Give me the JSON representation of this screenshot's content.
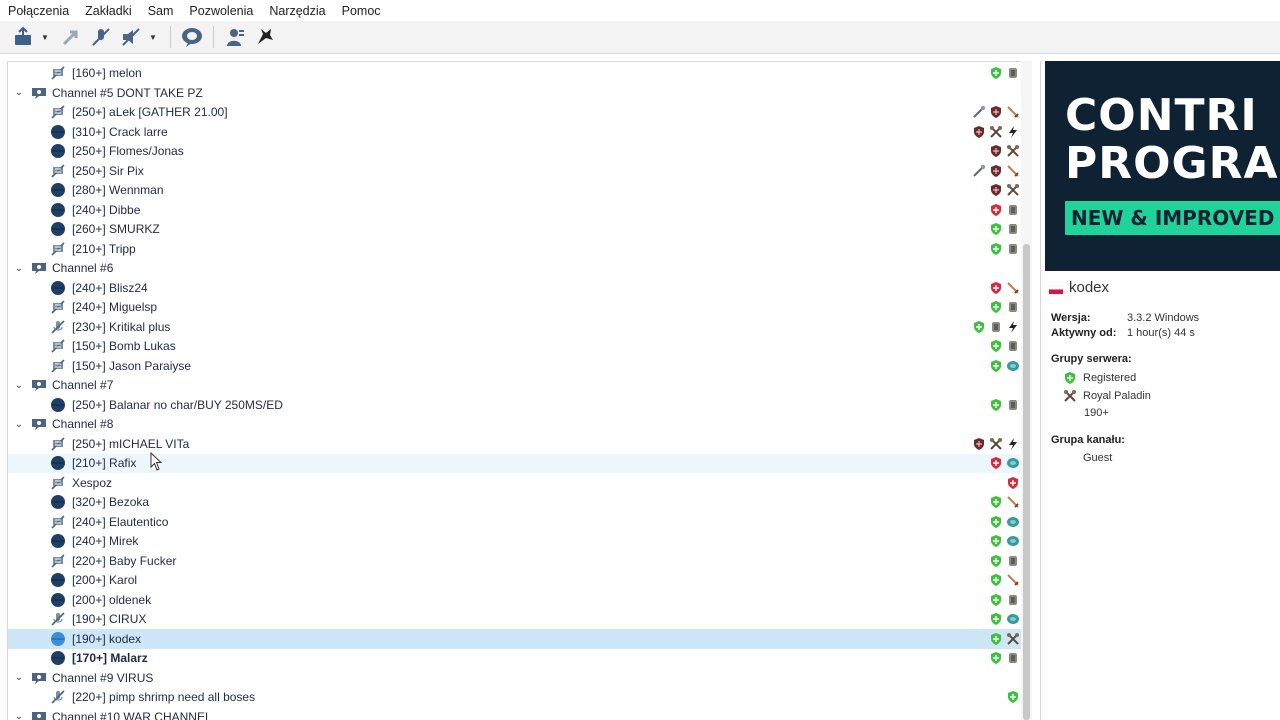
{
  "menu": [
    "Połączenia",
    "Zakładki",
    "Sam",
    "Pozwolenia",
    "Narzędzia",
    "Pomoc"
  ],
  "tree": [
    {
      "kind": "user",
      "name": "[160+] melon",
      "icon": "muted-user-icon",
      "badges": [
        "green-shield",
        "gray-armor"
      ]
    },
    {
      "kind": "channel",
      "name": "Channel #5 DONT TAKE PZ"
    },
    {
      "kind": "user",
      "name": "[250+] aLek [GATHER 21.00]",
      "icon": "muted-user-icon",
      "badges": [
        "wand",
        "dark-shield",
        "sword"
      ]
    },
    {
      "kind": "user",
      "name": "[310+] Crack larre",
      "icon": "idle-user-icon",
      "badges": [
        "dark-shield",
        "cross-axes",
        "bolt"
      ]
    },
    {
      "kind": "user",
      "name": "[250+] Flomes/Jonas",
      "icon": "idle-user-icon",
      "badges": [
        "dark-shield",
        "cross-axes"
      ]
    },
    {
      "kind": "user",
      "name": "[250+] Sir Pix",
      "icon": "muted-user-icon",
      "badges": [
        "wand",
        "dark-shield",
        "sword"
      ]
    },
    {
      "kind": "user",
      "name": "[280+] Wennman",
      "icon": "idle-user-icon",
      "badges": [
        "dark-shield",
        "cross-axes"
      ]
    },
    {
      "kind": "user",
      "name": "[240+] Dibbe",
      "icon": "idle-user-icon",
      "badges": [
        "red-shield",
        "gray-armor"
      ]
    },
    {
      "kind": "user",
      "name": "[260+] SMURKZ",
      "icon": "idle-user-icon",
      "badges": [
        "green-shield",
        "gray-armor"
      ]
    },
    {
      "kind": "user",
      "name": "[210+] Tripp",
      "icon": "muted-user-icon",
      "badges": [
        "green-shield",
        "gray-armor"
      ]
    },
    {
      "kind": "channel",
      "name": "Channel #6"
    },
    {
      "kind": "user",
      "name": "[240+] Blisz24",
      "icon": "idle-user-icon",
      "badges": [
        "red-shield",
        "sword"
      ]
    },
    {
      "kind": "user",
      "name": "[240+] Miguelsp",
      "icon": "muted-user-icon",
      "badges": [
        "green-shield",
        "gray-armor"
      ]
    },
    {
      "kind": "user",
      "name": "[230+] Kritikal plus",
      "icon": "away-user-icon",
      "badges": [
        "green-shield",
        "gray-armor",
        "bolt"
      ]
    },
    {
      "kind": "user",
      "name": "[150+] Bomb Lukas",
      "icon": "muted-user-icon",
      "badges": [
        "green-shield",
        "gray-armor"
      ]
    },
    {
      "kind": "user",
      "name": "[150+] Jason Paraiyse",
      "icon": "muted-user-icon",
      "badges": [
        "green-shield",
        "teal-orb"
      ]
    },
    {
      "kind": "channel",
      "name": "Channel #7"
    },
    {
      "kind": "user",
      "name": "[250+] Balanar no char/BUY 250MS/ED",
      "icon": "idle-user-icon",
      "badges": [
        "green-shield",
        "gray-armor"
      ]
    },
    {
      "kind": "channel",
      "name": "Channel #8"
    },
    {
      "kind": "user",
      "name": "[250+] mICHAEL VITa",
      "icon": "muted-user-icon",
      "badges": [
        "dark-shield",
        "cross-axes",
        "bolt"
      ]
    },
    {
      "kind": "user",
      "name": "[210+] Rafix",
      "icon": "idle-user-icon",
      "badges": [
        "red-shield",
        "teal-orb"
      ],
      "state": "hover"
    },
    {
      "kind": "user",
      "name": "Xespoz",
      "icon": "muted-user-icon",
      "badges": [
        "red-shield"
      ]
    },
    {
      "kind": "user",
      "name": "[320+] Bezoka",
      "icon": "idle-user-icon",
      "badges": [
        "green-shield",
        "sword"
      ]
    },
    {
      "kind": "user",
      "name": "[240+] Elautentico",
      "icon": "muted-user-icon",
      "badges": [
        "green-shield",
        "teal-orb"
      ]
    },
    {
      "kind": "user",
      "name": "[240+] Mirek",
      "icon": "idle-user-icon",
      "badges": [
        "green-shield",
        "teal-orb"
      ]
    },
    {
      "kind": "user",
      "name": "[220+] Baby Fucker",
      "icon": "muted-user-icon",
      "badges": [
        "green-shield",
        "gray-armor"
      ]
    },
    {
      "kind": "user",
      "name": "[200+] Karol",
      "icon": "idle-user-icon",
      "badges": [
        "green-shield",
        "sword"
      ]
    },
    {
      "kind": "user",
      "name": "[200+] oldenek",
      "icon": "idle-user-icon",
      "badges": [
        "green-shield",
        "gray-armor"
      ]
    },
    {
      "kind": "user",
      "name": "[190+] CIRUX",
      "icon": "away-user-icon",
      "badges": [
        "green-shield",
        "teal-orb"
      ]
    },
    {
      "kind": "user",
      "name": "[190+] kodex",
      "icon": "idle-user-icon-blue",
      "badges": [
        "green-shield",
        "cross-axes"
      ],
      "state": "selected"
    },
    {
      "kind": "user",
      "name": "[170+] Malarz",
      "icon": "idle-user-icon",
      "badges": [
        "green-shield",
        "gray-armor"
      ],
      "bold": true
    },
    {
      "kind": "channel",
      "name": "Channel #9 VIRUS"
    },
    {
      "kind": "user",
      "name": "[220+] pimp shrimp need all boses",
      "icon": "away-user-icon",
      "badges": [
        "green-shield"
      ]
    },
    {
      "kind": "channel",
      "name": "Channel #10 WAR CHANNEL"
    }
  ],
  "info": {
    "banner_line1": "CONTRI",
    "banner_line2": "PROGRA",
    "banner_line3": "NEW & IMPROVED",
    "client_name": "kodex",
    "version_label": "Wersja:",
    "version_value": "3.3.2 Windows",
    "active_label": "Aktywny od:",
    "active_value": "1 hour(s) 44 s",
    "server_groups_title": "Grupy serwera:",
    "server_groups": [
      "Registered",
      "Royal Paladin"
    ],
    "server_groups_extra": "190+",
    "channel_group_title": "Grupa kanału:",
    "channel_group_value": "Guest"
  },
  "colors": {
    "selected_row": "#cde6f8",
    "hover_row": "#eef6fd",
    "banner_bg": "#0f2233",
    "banner_accent": "#1fd39a",
    "idle_user": "#1e3f66"
  }
}
